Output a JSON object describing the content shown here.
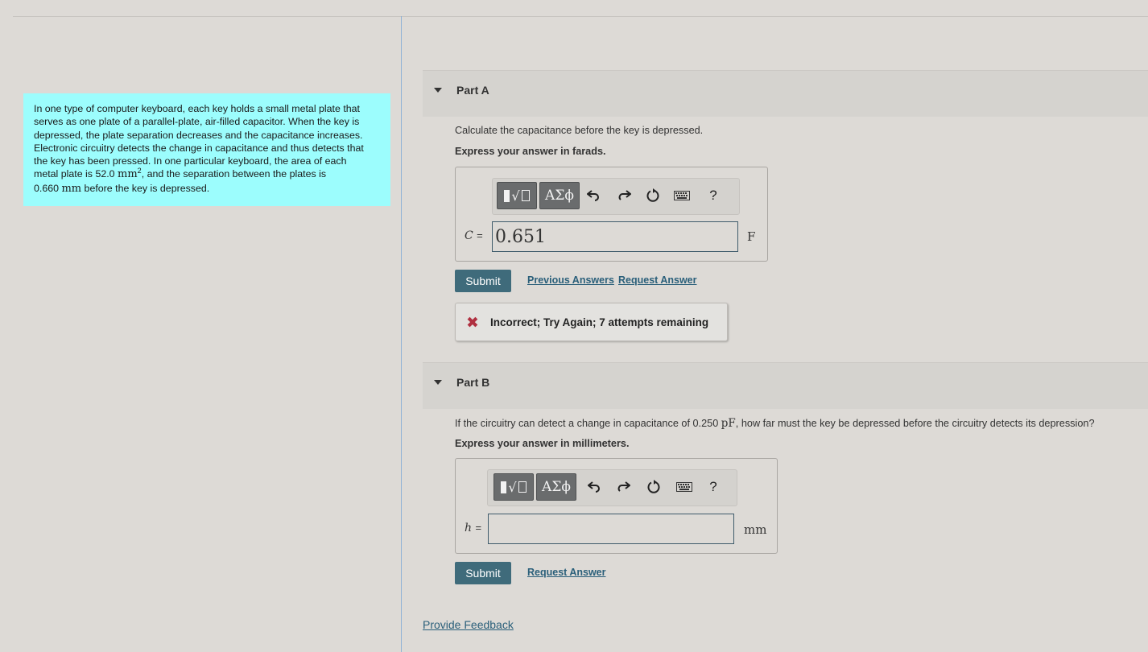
{
  "problem": {
    "line1": "In one type of computer keyboard, each key holds a small metal plate that",
    "line2": "serves as one plate of a parallel-plate, air-filled capacitor. When the key is",
    "line3": "depressed, the plate separation decreases and the capacitance increases.",
    "line4": "Electronic circuitry detects the change in capacitance and thus detects that",
    "line5": "the key has been pressed. In one particular keyboard, the area of each",
    "line6_a": "metal plate is 52.0 ",
    "line6_unit": "mm",
    "line6_sup": "2",
    "line6_b": ", and the separation between the plates is",
    "line7_a": "0.660 ",
    "line7_unit": "mm",
    "line7_b": " before the key is depressed."
  },
  "partA": {
    "title": "Part A",
    "question": "Calculate the capacitance before the key is depressed.",
    "express": "Express your answer in farads.",
    "template_icon": "template-icon",
    "greek_label": "ΑΣϕ",
    "help_label": "?",
    "var_label": "C",
    "eq": "=",
    "input_value": "0.651",
    "unit": "F",
    "submit_label": "Submit",
    "prev_answers_label": "Previous Answers",
    "request_answer_label": "Request Answer",
    "feedback_mark": "✖",
    "feedback_text": "Incorrect; Try Again; 7 attempts remaining"
  },
  "partB": {
    "title": "Part B",
    "question_a": "If the circuitry can detect a change in capacitance of 0.250 ",
    "question_unit": "pF",
    "question_b": ", how far must the key be depressed before the circuitry detects its depression?",
    "express": "Express your answer in millimeters.",
    "greek_label": "ΑΣϕ",
    "help_label": "?",
    "var_label": "h",
    "eq": "=",
    "input_value": "",
    "unit": "mm",
    "submit_label": "Submit",
    "request_answer_label": "Request Answer"
  },
  "footer": {
    "feedback_label": "Provide Feedback"
  },
  "colors": {
    "background": "#dddad6",
    "problem_bg": "#9cfdfd",
    "submit_bg": "#3f6b7b",
    "link": "#2a5f7a",
    "error_mark": "#b03040"
  }
}
